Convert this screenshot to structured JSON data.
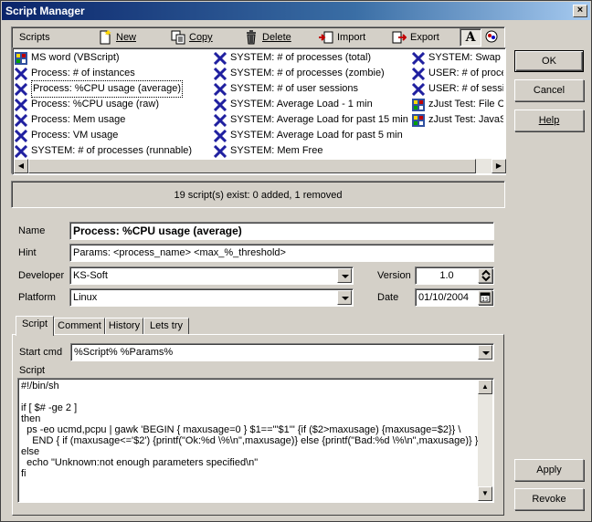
{
  "window": {
    "title": "Script Manager",
    "close": "×"
  },
  "toolbar": {
    "label": "Scripts",
    "new": "New",
    "copy": "Copy",
    "delete": "Delete",
    "import": "Import",
    "export": "Export",
    "font": "A"
  },
  "scripts": {
    "col1": [
      {
        "label": "MS word (VBScript)",
        "icon": "vbscript-icon"
      },
      {
        "label": "Process: # of instances",
        "icon": "x-script-icon"
      },
      {
        "label": "Process: %CPU usage (average)",
        "icon": "x-script-icon",
        "selected": true
      },
      {
        "label": "Process: %CPU usage (raw)",
        "icon": "x-script-icon"
      },
      {
        "label": "Process: Mem usage",
        "icon": "x-script-icon"
      },
      {
        "label": "Process: VM usage",
        "icon": "x-script-icon"
      },
      {
        "label": "SYSTEM: # of processes (runnable)",
        "icon": "x-script-icon"
      }
    ],
    "col2": [
      {
        "label": "SYSTEM: # of processes (total)",
        "icon": "x-script-icon"
      },
      {
        "label": "SYSTEM: # of processes (zombie)",
        "icon": "x-script-icon"
      },
      {
        "label": "SYSTEM: # of user sessions",
        "icon": "x-script-icon"
      },
      {
        "label": "SYSTEM: Average Load - 1 min",
        "icon": "x-script-icon"
      },
      {
        "label": "SYSTEM: Average Load for past 15 min",
        "icon": "x-script-icon"
      },
      {
        "label": "SYSTEM: Average Load for past 5 min",
        "icon": "x-script-icon"
      },
      {
        "label": "SYSTEM: Mem Free",
        "icon": "x-script-icon"
      }
    ],
    "col3": [
      {
        "label": "SYSTEM: Swap F",
        "icon": "x-script-icon"
      },
      {
        "label": "USER: # of proce",
        "icon": "x-script-icon"
      },
      {
        "label": "USER: # of sessio",
        "icon": "x-script-icon"
      },
      {
        "label": "zJust Test: File Co",
        "icon": "vbscript-icon"
      },
      {
        "label": "zJust Test: JavaS",
        "icon": "vbscript-icon"
      }
    ]
  },
  "status": "19 script(s) exist: 0 added, 1 removed",
  "form": {
    "name_label": "Name",
    "name_value": "Process: %CPU usage (average)",
    "hint_label": "Hint",
    "hint_value": "Params: <process_name>  <max_%_threshold>",
    "developer_label": "Developer",
    "developer_value": "KS-Soft",
    "version_label": "Version",
    "version_value": "1.0",
    "platform_label": "Platform",
    "platform_value": "Linux",
    "date_label": "Date",
    "date_value": "01/10/2004"
  },
  "tabs": [
    "Script",
    "Comment",
    "History",
    "Lets try"
  ],
  "script_tab": {
    "start_cmd_label": "Start cmd",
    "start_cmd_value": "%Script% %Params%",
    "script_label": "Script",
    "lines": [
      "#!/bin/sh",
      "",
      "if [ $# -ge 2 ]",
      "then",
      "  ps -eo ucmd,pcpu | gawk 'BEGIN { maxusage=0 } $1==\"'$1'\" {if ($2>maxusage) {maxusage=$2}} \\",
      "    END { if (maxusage<='$2') {printf(\"Ok:%d \\%\\n\",maxusage)} else {printf(\"Bad:%d \\%\\n\",maxusage)} }'",
      "else",
      "  echo \"Unknown:not enough parameters specified\\n\"",
      "fi"
    ]
  },
  "buttons": {
    "ok": "OK",
    "cancel": "Cancel",
    "help": "Help",
    "apply": "Apply",
    "revoke": "Revoke"
  }
}
